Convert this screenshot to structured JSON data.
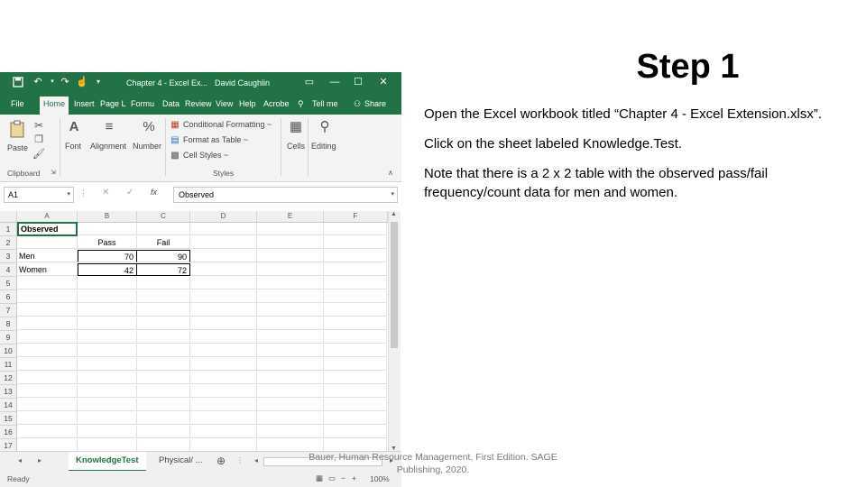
{
  "slide": {
    "title": "Step 1",
    "paragraphs": [
      "Open the Excel workbook titled “Chapter 4 - Excel Extension.xlsx”.",
      "Click on the sheet labeled Knowledge.Test.",
      "Note that there is a 2 x 2 table with the observed pass/fail frequency/count data for men and women."
    ],
    "footer": "Bauer, Human Resource Management, First Edition. SAGE Publishing, 2020."
  },
  "excel": {
    "window_title": "Chapter 4 - Excel Ex...",
    "user": "David Caughlin",
    "tabs": [
      "File",
      "Home",
      "Insert",
      "Page L",
      "Formu",
      "Data",
      "Review",
      "View",
      "Help",
      "Acrobe"
    ],
    "tell_me": "Tell me",
    "share": "Share",
    "ribbon": {
      "paste": "Paste",
      "font": "Font",
      "alignment": "Alignment",
      "number": "Number",
      "conditional_formatting": "Conditional Formatting ~",
      "format_as_table": "Format as Table ~",
      "cell_styles": "Cell Styles ~",
      "cells": "Cells",
      "editing": "Editing",
      "clipboard_group": "Clipboard",
      "styles_group": "Styles"
    },
    "name_box": "A1",
    "formula": "Observed",
    "columns": [
      "A",
      "B",
      "C",
      "D",
      "E",
      "F"
    ],
    "rows": [
      "1",
      "2",
      "3",
      "4",
      "5",
      "6",
      "7",
      "8",
      "9",
      "10",
      "11",
      "12",
      "13",
      "14",
      "15",
      "16",
      "17"
    ],
    "cells": {
      "a1": "Observed",
      "b2": "Pass",
      "c2": "Fail",
      "a3": "Men",
      "b3": "70",
      "c3": "90",
      "a4": "Women",
      "b4": "42",
      "c4": "72"
    },
    "sheet_tabs": [
      "KnowledgeTest",
      "Physical/ ..."
    ],
    "status": "Ready",
    "zoom": "100%"
  },
  "colors": {
    "excel_green": "#217346",
    "footer_grey": "#7a7a7a"
  }
}
